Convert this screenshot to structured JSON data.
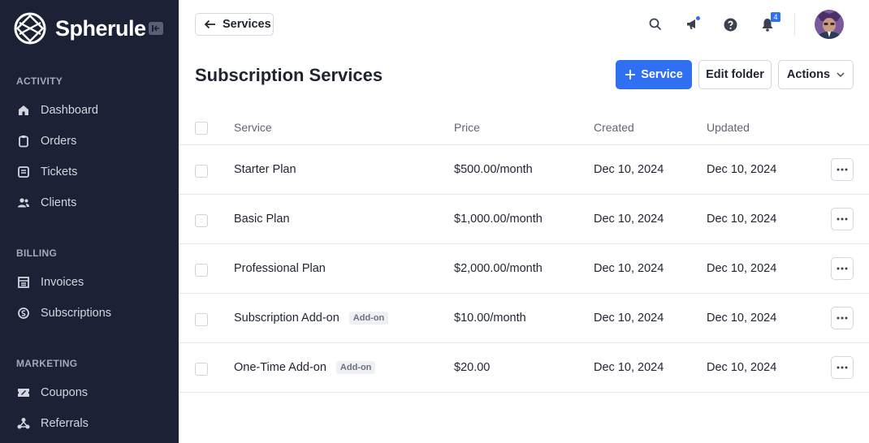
{
  "brand": {
    "name": "Spherule"
  },
  "sidebar": {
    "sections": [
      {
        "label": "ACTIVITY",
        "items": [
          {
            "label": "Dashboard",
            "icon": "home-icon"
          },
          {
            "label": "Orders",
            "icon": "clipboard-icon"
          },
          {
            "label": "Tickets",
            "icon": "ticket-icon"
          },
          {
            "label": "Clients",
            "icon": "users-icon"
          }
        ]
      },
      {
        "label": "BILLING",
        "items": [
          {
            "label": "Invoices",
            "icon": "invoice-icon"
          },
          {
            "label": "Subscriptions",
            "icon": "subscription-icon"
          }
        ]
      },
      {
        "label": "MARKETING",
        "items": [
          {
            "label": "Coupons",
            "icon": "coupon-icon"
          },
          {
            "label": "Referrals",
            "icon": "referral-icon"
          }
        ]
      }
    ]
  },
  "topbar": {
    "back_label": "Services",
    "notification_count": "4"
  },
  "header": {
    "title": "Subscription Services",
    "add_service_label": "Service",
    "edit_folder_label": "Edit folder",
    "actions_label": "Actions"
  },
  "table": {
    "columns": [
      "Service",
      "Price",
      "Created",
      "Updated"
    ],
    "rows": [
      {
        "service": "Starter Plan",
        "badge": "",
        "price": "$500.00/month",
        "created": "Dec 10, 2024",
        "updated": "Dec 10, 2024"
      },
      {
        "service": "Basic Plan",
        "badge": "",
        "price": "$1,000.00/month",
        "created": "Dec 10, 2024",
        "updated": "Dec 10, 2024"
      },
      {
        "service": "Professional Plan",
        "badge": "",
        "price": "$2,000.00/month",
        "created": "Dec 10, 2024",
        "updated": "Dec 10, 2024"
      },
      {
        "service": "Subscription Add-on",
        "badge": "Add-on",
        "price": "$10.00/month",
        "created": "Dec 10, 2024",
        "updated": "Dec 10, 2024"
      },
      {
        "service": "One-Time Add-on",
        "badge": "Add-on",
        "price": "$20.00",
        "created": "Dec 10, 2024",
        "updated": "Dec 10, 2024"
      }
    ]
  },
  "colors": {
    "sidebar_bg": "#1c2135",
    "accent": "#2f6ff2"
  }
}
